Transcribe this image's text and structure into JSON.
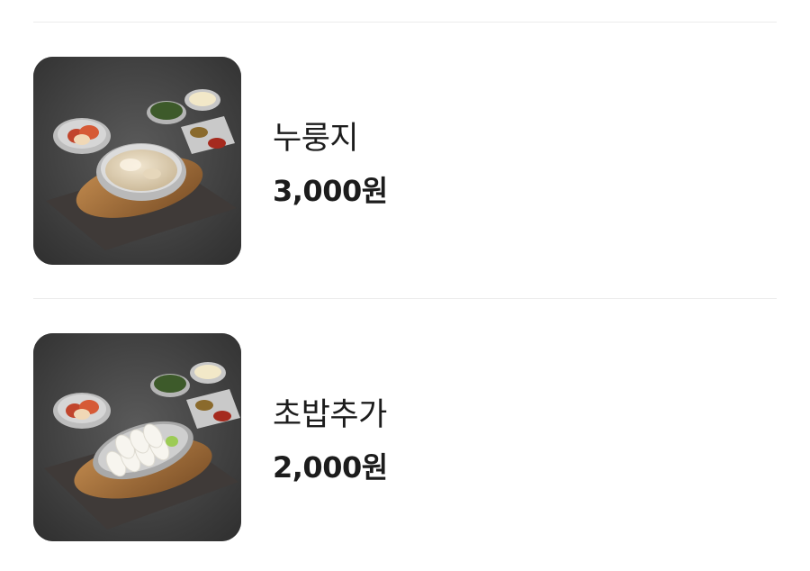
{
  "menu": {
    "items": [
      {
        "name": "누룽지",
        "price": "3,000원",
        "image_icon": "nurungji-soup-photo"
      },
      {
        "name": "초밥추가",
        "price": "2,000원",
        "image_icon": "sushi-rice-plate-photo"
      }
    ]
  }
}
